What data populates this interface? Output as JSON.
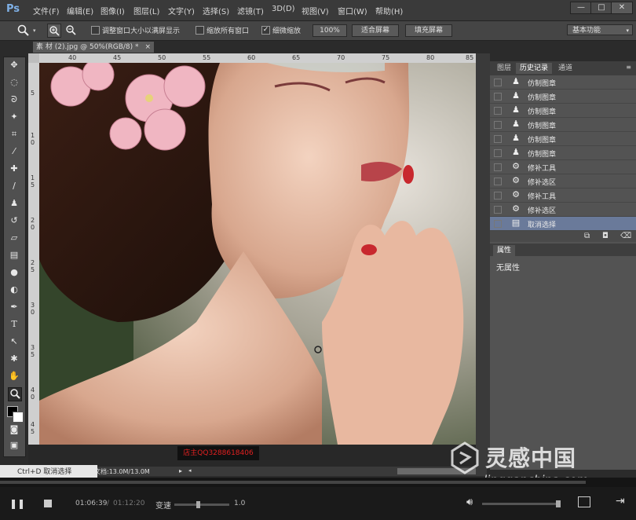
{
  "app": {
    "logo": "Ps"
  },
  "menu": [
    "文件(F)",
    "编辑(E)",
    "图像(I)",
    "图层(L)",
    "文字(Y)",
    "选择(S)",
    "滤镜(T)",
    "3D(D)",
    "视图(V)",
    "窗口(W)",
    "帮助(H)"
  ],
  "window_controls": {
    "minimize": "—",
    "maximize": "□",
    "close": "✕"
  },
  "options": {
    "resize_label": "调整窗口大小以满屏显示",
    "zoom_all_label": "缩放所有窗口",
    "scrubby_label": "细微缩放",
    "zoom_100": "100%",
    "fit_screen": "适合屏幕",
    "fill_screen": "填充屏幕",
    "workspace": "基本功能"
  },
  "document": {
    "tab_title": "素 材 (2).jpg @ 50%(RGB/8) *",
    "tab_close": "×",
    "ruler_top": [
      "40",
      "45",
      "50",
      "55",
      "60",
      "65",
      "70",
      "75",
      "80",
      "85"
    ],
    "ruler_left": [
      "5",
      "1 0",
      "1 5",
      "2 0",
      "2 5",
      "3 0",
      "3 5",
      "4 0",
      "4 5",
      "5 0"
    ],
    "status": "文档:13.0M/13.0M",
    "red_watermark": "店主QQ3288618406"
  },
  "panel": {
    "tabs": [
      "图层",
      "历史记录",
      "通道"
    ],
    "active_tab": "历史记录",
    "history": [
      {
        "icon": "stamp-icon",
        "label": "仿制图章"
      },
      {
        "icon": "stamp-icon",
        "label": "仿制图章"
      },
      {
        "icon": "stamp-icon",
        "label": "仿制图章"
      },
      {
        "icon": "stamp-icon",
        "label": "仿制图章"
      },
      {
        "icon": "stamp-icon",
        "label": "仿制图章"
      },
      {
        "icon": "stamp-icon",
        "label": "仿制图章"
      },
      {
        "icon": "patch-icon",
        "label": "修补工具"
      },
      {
        "icon": "patch-icon",
        "label": "修补选区"
      },
      {
        "icon": "patch-icon",
        "label": "修补工具"
      },
      {
        "icon": "patch-icon",
        "label": "修补选区"
      },
      {
        "icon": "deselect-icon",
        "label": "取消选择"
      }
    ],
    "properties_tab": "属性",
    "properties_value": "无属性"
  },
  "tooltip": "Ctrl+D 取消选择",
  "player": {
    "current_time": "01:06:39",
    "separator": "/",
    "total_time": "01:12:20",
    "speed_label": "变速",
    "speed_value": "1.0",
    "progress": 0.921,
    "speed_fraction": 0.4
  },
  "brand": {
    "cn": "灵感中国",
    "url": "lingganchina.com"
  }
}
